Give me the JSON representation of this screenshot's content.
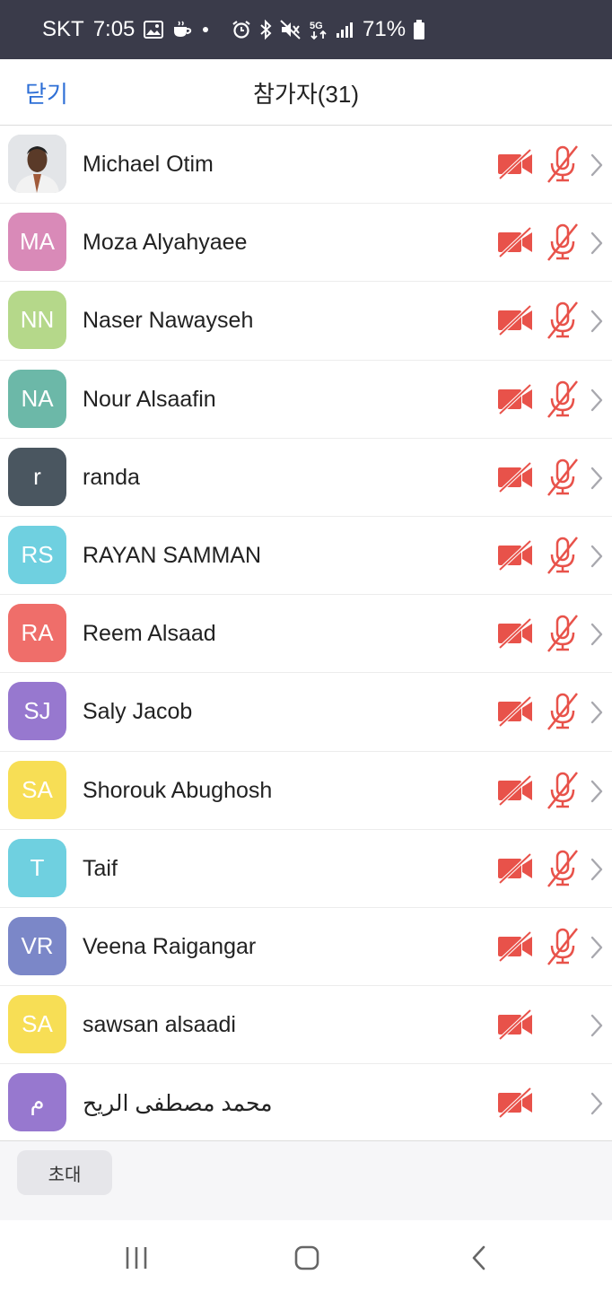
{
  "status_bar": {
    "carrier": "SKT",
    "time": "7:05",
    "battery": "71%",
    "network": "5G"
  },
  "header": {
    "close_label": "닫기",
    "title": "참가자(31)"
  },
  "participants": [
    {
      "name": "Michael Otim",
      "initials": "",
      "avatar_color": "",
      "photo": true,
      "video_muted": true,
      "audio_muted": true
    },
    {
      "name": "Moza Alyahyaee",
      "initials": "MA",
      "avatar_color": "#d98ab8",
      "photo": false,
      "video_muted": true,
      "audio_muted": true
    },
    {
      "name": "Naser Nawayseh",
      "initials": "NN",
      "avatar_color": "#b5d88a",
      "photo": false,
      "video_muted": true,
      "audio_muted": true
    },
    {
      "name": "Nour Alsaafin",
      "initials": "NA",
      "avatar_color": "#6cb8a8",
      "photo": false,
      "video_muted": true,
      "audio_muted": true
    },
    {
      "name": "randa",
      "initials": "r",
      "avatar_color": "#4a5660",
      "photo": false,
      "video_muted": true,
      "audio_muted": true
    },
    {
      "name": "RAYAN SAMMAN",
      "initials": "RS",
      "avatar_color": "#6fd0e0",
      "photo": false,
      "video_muted": true,
      "audio_muted": true
    },
    {
      "name": "Reem Alsaad",
      "initials": "RA",
      "avatar_color": "#ef6e6a",
      "photo": false,
      "video_muted": true,
      "audio_muted": true
    },
    {
      "name": "Saly Jacob",
      "initials": "SJ",
      "avatar_color": "#9778cf",
      "photo": false,
      "video_muted": true,
      "audio_muted": true
    },
    {
      "name": "Shorouk Abughosh",
      "initials": "SA",
      "avatar_color": "#f7de55",
      "photo": false,
      "video_muted": true,
      "audio_muted": true
    },
    {
      "name": "Taif",
      "initials": "T",
      "avatar_color": "#6fd0e0",
      "photo": false,
      "video_muted": true,
      "audio_muted": true
    },
    {
      "name": "Veena Raigangar",
      "initials": "VR",
      "avatar_color": "#7b87c8",
      "photo": false,
      "video_muted": true,
      "audio_muted": true
    },
    {
      "name": "sawsan alsaadi",
      "initials": "SA",
      "avatar_color": "#f7de55",
      "photo": false,
      "video_muted": true,
      "audio_muted": false
    },
    {
      "name": "محمد مصطفى الريح",
      "initials": "م",
      "avatar_color": "#9778cf",
      "photo": false,
      "video_muted": true,
      "audio_muted": false
    }
  ],
  "footer": {
    "invite_label": "초대"
  },
  "colors": {
    "accent": "#2e6fd6",
    "muted_red": "#e8524a",
    "status_bar_bg": "#3a3b4a"
  },
  "icons": {
    "video_muted": "video-off-icon",
    "audio_muted": "mic-off-icon",
    "row_detail": "chevron-right-icon"
  }
}
